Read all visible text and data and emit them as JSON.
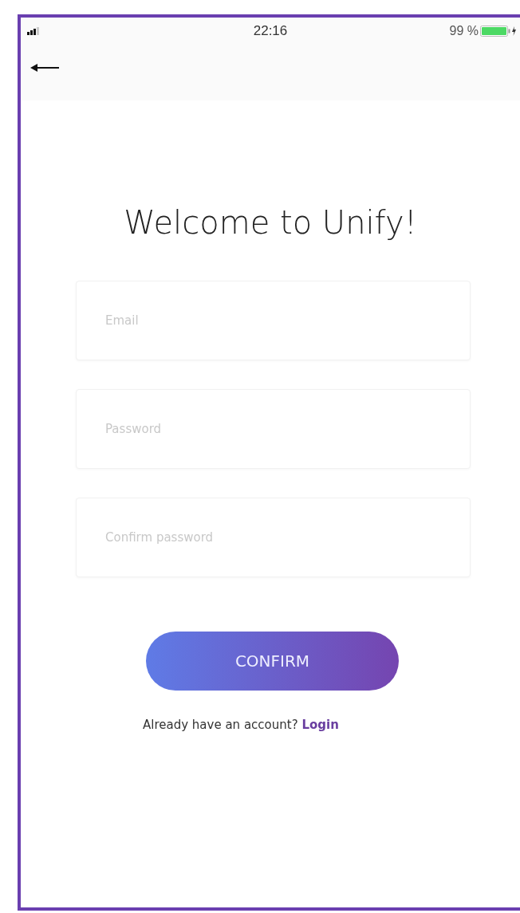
{
  "status_bar": {
    "time": "22:16",
    "battery": "99 %"
  },
  "title": "Welcome to Unify!",
  "fields": [
    {
      "placeholder": "Email"
    },
    {
      "placeholder": "Password"
    },
    {
      "placeholder": "Confirm password"
    }
  ],
  "confirm_button": "CONFIRM",
  "footer": {
    "text": "Already have an account?",
    "link": "Login"
  }
}
